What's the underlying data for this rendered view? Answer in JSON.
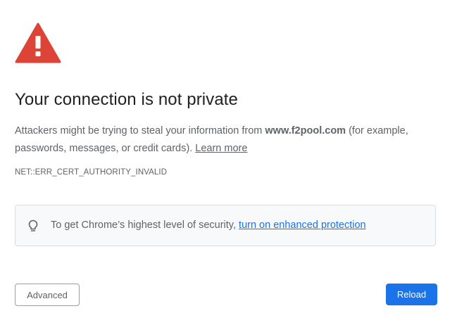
{
  "colors": {
    "warning_red": "#db4437",
    "accent_blue": "#1a73e8",
    "body_text": "#5f6368",
    "heading_text": "#202124"
  },
  "icons": {
    "warning": "warning-triangle-icon",
    "lightbulb": "lightbulb-icon"
  },
  "heading": "Your connection is not private",
  "explanation": {
    "prefix": "Attackers might be trying to steal your information from ",
    "domain": "www.f2pool.com",
    "suffix": " (for example, passwords, messages, or credit cards). ",
    "learn_more": "Learn more"
  },
  "error_code": "NET::ERR_CERT_AUTHORITY_INVALID",
  "enhanced_protection": {
    "text": "To get Chrome’s highest level of security, ",
    "link": "turn on enhanced protection"
  },
  "buttons": {
    "advanced": "Advanced",
    "reload": "Reload"
  }
}
